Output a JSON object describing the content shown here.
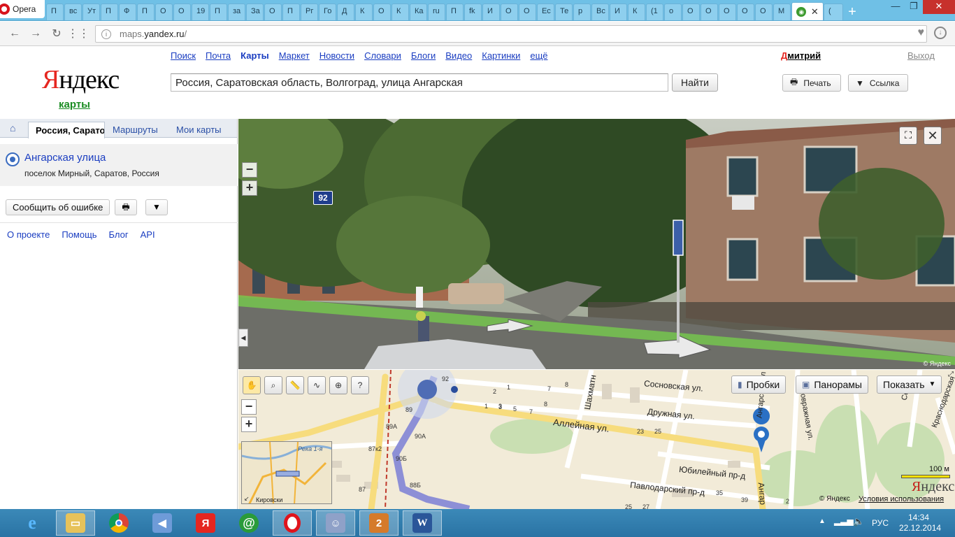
{
  "browser": {
    "menu_label": "Opera",
    "tab_stubs": [
      "П",
      "вс",
      "Ут",
      "П",
      "Ф",
      "П",
      "О",
      "О",
      "19",
      "П",
      "за",
      "За",
      "О",
      "П",
      "Рг",
      "Го",
      "Д",
      "К",
      "О",
      "К",
      "Ка",
      "ru",
      "П",
      "fk",
      "И",
      "О",
      "О",
      "Ес",
      "Те",
      "р",
      "Вс",
      "И",
      "К",
      "(1",
      "о",
      "О",
      "О",
      "О",
      "О",
      "О",
      "М"
    ],
    "active_tab_icon": "yandex-maps-icon",
    "other_tab": "(",
    "url_prefix": "maps.",
    "url_domain": "yandex.ru",
    "url_suffix": "/"
  },
  "header": {
    "logo_first": "Я",
    "logo_rest": "ндекс",
    "logo_sub": "карты",
    "services": [
      {
        "label": "Поиск",
        "current": false
      },
      {
        "label": "Почта",
        "current": false
      },
      {
        "label": "Карты",
        "current": true
      },
      {
        "label": "Маркет",
        "current": false
      },
      {
        "label": "Новости",
        "current": false
      },
      {
        "label": "Словари",
        "current": false
      },
      {
        "label": "Блоги",
        "current": false
      },
      {
        "label": "Видео",
        "current": false
      },
      {
        "label": "Картинки",
        "current": false
      },
      {
        "label": "ещё",
        "current": false
      }
    ],
    "user_first": "Д",
    "user_rest": "митрий",
    "logout": "Выход",
    "search_value": "Россия, Саратовская область, Волгоград, улица Ангарская",
    "search_button": "Найти",
    "print_label": "Печать",
    "link_label": "Ссылка"
  },
  "left_panel": {
    "tabs": [
      "Россия, Саратовская",
      "Маршруты",
      "Мои карты"
    ],
    "result_name": "Ангарская улица",
    "result_address": "поселок Мирный, Саратов, Россия",
    "report_button": "Сообщить об ошибке",
    "footer_links": [
      "О проекте",
      "Помощь",
      "Блог",
      "API"
    ]
  },
  "panorama": {
    "house_number": "92",
    "copyright": "© Яндекс"
  },
  "map": {
    "traffic_label": "Пробки",
    "panoramas_label": "Панорамы",
    "show_label": "Показать",
    "streets": {
      "sosnovskaya": "Сосновская ул.",
      "druzhnaya": "Дружная ул.",
      "alleynaya": "Аллейная ул.",
      "yubileyny": "Юбилейный пр-д",
      "pavlodarsky": "Павлодарский пр-д",
      "shakhmatnaya": "Шахматн",
      "angarskaya_top": "Ангарская ул",
      "angarskaya_bottom": "Ангар",
      "sekovrazhnaya": "Сековражная ул.",
      "sevastopolskaya": "Севас",
      "krasnodarskaya": "Краснодарская",
      "minimap_river": "Река 1-я",
      "minimap_district": "Кировски"
    },
    "house_numbers": [
      "92",
      "2",
      "1",
      "3",
      "7",
      "8",
      "89",
      "1",
      "3",
      "5",
      "7",
      "8",
      "89А",
      "90А",
      "87к2",
      "90Б",
      "88Б",
      "87",
      "23",
      "25",
      "35",
      "39",
      "2",
      "25",
      "27"
    ],
    "scale_label": "100 м",
    "logo_first": "Я",
    "logo_rest": "ндекс",
    "copyright": "© Яндекс",
    "terms": "Условия использования"
  },
  "taskbar": {
    "language": "РУС",
    "time": "14:34",
    "date": "22.12.2014"
  }
}
